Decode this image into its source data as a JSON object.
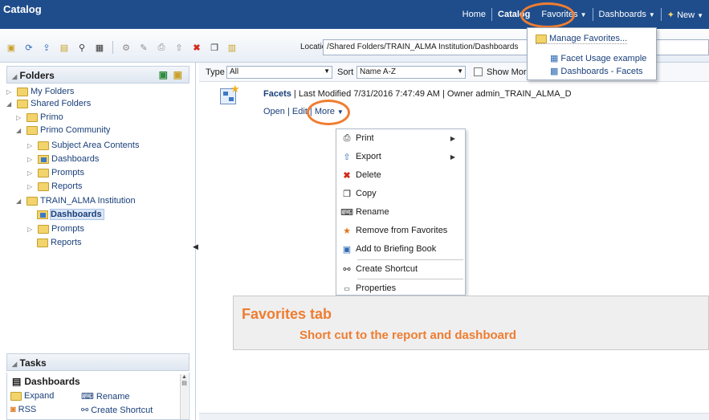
{
  "app": {
    "title": "Catalog"
  },
  "topnav": {
    "home": "Home",
    "catalog": "Catalog",
    "favorites": "Favorites",
    "dashboards": "Dashboards",
    "new": "New"
  },
  "favorites_menu": {
    "items": [
      "Manage Favorites...",
      "Facet Usage example",
      "Dashboards - Facets"
    ]
  },
  "toolbar": {
    "location_label": "Location",
    "location_value": "/Shared Folders/TRAIN_ALMA Institution/Dashboards"
  },
  "folders": {
    "title": "Folders",
    "tree": [
      {
        "label": "My Folders",
        "level": 0,
        "state": "collapsed"
      },
      {
        "label": "Shared Folders",
        "level": 0,
        "state": "expanded"
      },
      {
        "label": "Primo",
        "level": 1,
        "state": "collapsed"
      },
      {
        "label": "Primo Community",
        "level": 1,
        "state": "expanded"
      },
      {
        "label": "Subject Area Contents",
        "level": 2,
        "state": "collapsed"
      },
      {
        "label": "Dashboards",
        "level": 2,
        "state": "collapsed"
      },
      {
        "label": "Prompts",
        "level": 2,
        "state": "collapsed"
      },
      {
        "label": "Reports",
        "level": 2,
        "state": "collapsed"
      },
      {
        "label": "TRAIN_ALMA Institution",
        "level": 1,
        "state": "expanded"
      },
      {
        "label": "Dashboards",
        "level": 2,
        "state": "selected"
      },
      {
        "label": "Prompts",
        "level": 2,
        "state": "collapsed"
      },
      {
        "label": "Reports",
        "level": 2,
        "state": "leaf"
      }
    ]
  },
  "tasks": {
    "title": "Tasks",
    "section": "Dashboards",
    "items": [
      "Expand",
      "Rename",
      "RSS",
      "Create Shortcut"
    ]
  },
  "filter": {
    "type_label": "Type",
    "type_value": "All",
    "sort_label": "Sort",
    "sort_value": "Name A-Z",
    "show_more": "Show More"
  },
  "item": {
    "name": "Facets",
    "meta": "| Last Modified 7/31/2016 7:47:49 AM | Owner admin_TRAIN_ALMA_D",
    "open": "Open",
    "edit": "Edit",
    "more": "More"
  },
  "more_menu": {
    "items": [
      "Print",
      "Export",
      "Delete",
      "Copy",
      "Rename",
      "Remove from Favorites",
      "Add to Briefing Book",
      "Create Shortcut",
      "Properties"
    ]
  },
  "callout": {
    "title": "Favorites tab",
    "subtitle": "Short cut to the report and dashboard"
  },
  "colors": {
    "topbar": "#1f4d8c",
    "accent": "#ef7d31"
  }
}
